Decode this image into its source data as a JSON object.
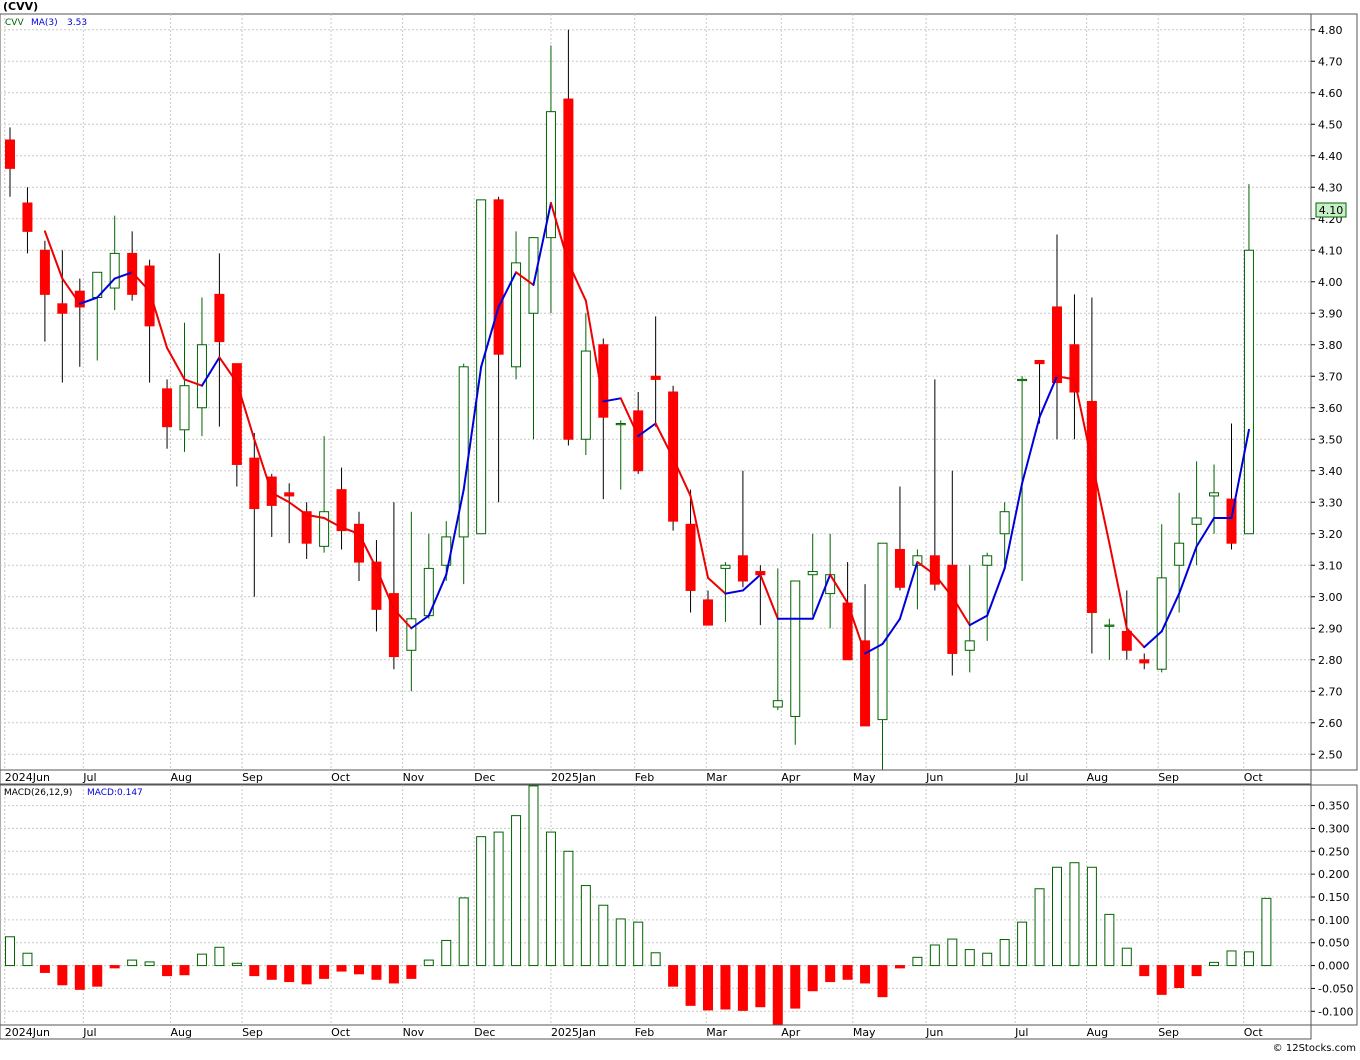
{
  "header": {
    "symbol_title": "(CVV)"
  },
  "price_panel": {
    "legend_symbol": "CVV",
    "legend_ma_label": "MA(3)",
    "legend_ma_value": "3.53",
    "last_price_badge": "4.10"
  },
  "macd_panel": {
    "legend_label": "MACD(26,12,9)",
    "legend_value": "MACD:0.147"
  },
  "footer": {
    "watermark": "© 12Stocks.com"
  },
  "colors": {
    "up": "#006400",
    "down": "#ff0000",
    "ma_up": "#0000dd",
    "ma_down": "#ee0000",
    "grid": "#c8c8c8",
    "badge_bg": "#c8f0c8"
  },
  "chart_data": [
    {
      "type": "candlestick",
      "interval": "weekly",
      "title": "(CVV)",
      "ylim": [
        2.45,
        4.85
      ],
      "y_ticks": [
        "2.50",
        "2.60",
        "2.70",
        "2.80",
        "2.90",
        "3.00",
        "3.10",
        "3.20",
        "3.30",
        "3.40",
        "3.50",
        "3.60",
        "3.70",
        "3.80",
        "3.90",
        "4.00",
        "4.10",
        "4.20",
        "4.30",
        "4.40",
        "4.50",
        "4.60",
        "4.70",
        "4.80"
      ],
      "x_tick_labels": [
        {
          "label": "2024Jun",
          "index": -0.3
        },
        {
          "label": "Jul",
          "index": 4.2
        },
        {
          "label": "Aug",
          "index": 9.2
        },
        {
          "label": "Sep",
          "index": 13.3
        },
        {
          "label": "Oct",
          "index": 18.4
        },
        {
          "label": "Nov",
          "index": 22.5
        },
        {
          "label": "Dec",
          "index": 26.6
        },
        {
          "label": "2025Jan",
          "index": 31.0
        },
        {
          "label": "Feb",
          "index": 35.8
        },
        {
          "label": "Mar",
          "index": 39.9
        },
        {
          "label": "Apr",
          "index": 44.2
        },
        {
          "label": "May",
          "index": 48.3
        },
        {
          "label": "Jun",
          "index": 52.5
        },
        {
          "label": "Jul",
          "index": 57.6
        },
        {
          "label": "Aug",
          "index": 61.7
        },
        {
          "label": "Sep",
          "index": 65.8
        },
        {
          "label": "Oct",
          "index": 70.7
        }
      ],
      "series": [
        {
          "kind": "ohlc",
          "open": [
            4.45,
            4.25,
            4.1,
            3.93,
            3.97,
            3.95,
            3.98,
            4.09,
            4.05,
            3.66,
            3.53,
            3.6,
            3.96,
            3.74,
            3.44,
            3.38,
            3.33,
            3.27,
            3.16,
            3.34,
            3.23,
            3.11,
            3.01,
            2.83,
            2.94,
            3.1,
            3.19,
            3.2,
            4.26,
            3.73,
            3.9,
            4.14,
            4.58,
            3.5,
            3.8,
            3.55,
            3.59,
            3.7,
            3.65,
            3.23,
            2.99,
            3.09,
            3.13,
            3.08,
            2.65,
            2.62,
            3.07,
            3.01,
            2.98,
            2.86,
            2.61,
            3.15,
            3.1,
            3.13,
            3.1,
            2.83,
            3.1,
            3.2,
            3.69,
            3.75,
            3.92,
            3.8,
            3.62,
            2.91,
            2.89,
            2.8,
            2.77,
            3.1,
            3.23,
            3.32,
            3.31,
            3.2
          ],
          "high": [
            4.49,
            4.3,
            4.13,
            4.1,
            4.01,
            4.02,
            4.21,
            4.16,
            4.07,
            3.69,
            3.87,
            3.95,
            4.09,
            3.74,
            3.52,
            3.39,
            3.36,
            3.3,
            3.51,
            3.41,
            3.27,
            3.18,
            3.3,
            3.27,
            3.2,
            3.24,
            3.74,
            3.75,
            4.27,
            4.16,
            4.0,
            4.75,
            4.8,
            3.9,
            3.82,
            3.56,
            3.65,
            3.89,
            3.67,
            3.34,
            3.02,
            3.11,
            3.4,
            3.1,
            3.09,
            3.03,
            3.2,
            3.2,
            3.11,
            3.04,
            3.1,
            3.35,
            3.15,
            3.69,
            3.4,
            3.1,
            3.14,
            3.3,
            3.7,
            3.75,
            4.15,
            3.96,
            3.95,
            2.93,
            3.02,
            2.82,
            3.23,
            3.33,
            3.43,
            3.42,
            3.55,
            4.31
          ],
          "low": [
            4.27,
            4.09,
            3.81,
            3.68,
            3.73,
            3.75,
            3.91,
            3.94,
            3.68,
            3.47,
            3.46,
            3.51,
            3.54,
            3.35,
            3.0,
            3.19,
            3.17,
            3.12,
            3.14,
            3.15,
            3.05,
            2.89,
            2.77,
            2.7,
            2.93,
            3.05,
            3.04,
            3.3,
            3.3,
            3.69,
            3.5,
            3.9,
            3.48,
            3.45,
            3.31,
            3.34,
            3.39,
            3.54,
            3.21,
            2.95,
            2.91,
            2.92,
            3.03,
            2.91,
            2.64,
            2.53,
            2.94,
            2.9,
            2.91,
            2.65,
            2.44,
            3.02,
            2.96,
            3.02,
            2.75,
            2.76,
            2.86,
            3.1,
            3.05,
            3.55,
            3.5,
            3.5,
            2.82,
            2.8,
            2.8,
            2.77,
            2.76,
            2.95,
            3.1,
            3.2,
            3.15,
            3.2
          ],
          "close": [
            4.36,
            4.16,
            3.96,
            3.9,
            3.92,
            4.03,
            4.09,
            3.96,
            3.86,
            3.54,
            3.67,
            3.8,
            3.81,
            3.42,
            3.28,
            3.29,
            3.32,
            3.17,
            3.27,
            3.21,
            3.11,
            2.96,
            2.81,
            2.93,
            3.09,
            3.19,
            3.73,
            4.26,
            3.77,
            4.06,
            4.14,
            4.54,
            3.5,
            3.78,
            3.57,
            3.55,
            3.4,
            3.69,
            3.24,
            3.02,
            2.91,
            3.1,
            3.05,
            3.07,
            2.67,
            3.05,
            3.08,
            3.07,
            2.8,
            2.59,
            3.17,
            3.03,
            3.13,
            3.04,
            2.82,
            2.86,
            3.13,
            3.27,
            3.69,
            3.74,
            3.68,
            3.65,
            2.95,
            2.91,
            2.83,
            2.79,
            3.06,
            3.17,
            3.25,
            3.33,
            3.17,
            4.1
          ]
        },
        {
          "kind": "moving_average",
          "name": "MA(3)",
          "values": [
            null,
            null,
            4.16,
            4.01,
            3.93,
            3.95,
            4.01,
            4.03,
            3.97,
            3.79,
            3.69,
            3.67,
            3.76,
            3.68,
            3.5,
            3.33,
            3.3,
            3.26,
            3.25,
            3.22,
            3.2,
            3.09,
            2.96,
            2.9,
            2.94,
            3.07,
            3.34,
            3.73,
            3.92,
            4.03,
            3.99,
            4.25,
            4.06,
            3.94,
            3.62,
            3.63,
            3.51,
            3.55,
            3.44,
            3.32,
            3.06,
            3.01,
            3.02,
            3.07,
            2.93,
            2.93,
            2.93,
            3.07,
            2.98,
            2.82,
            2.85,
            2.93,
            3.11,
            3.07,
            3.0,
            2.91,
            2.94,
            3.09,
            3.36,
            3.57,
            3.7,
            3.69,
            3.43,
            3.17,
            2.9,
            2.84,
            2.89,
            3.01,
            3.16,
            3.25,
            3.25,
            3.53
          ]
        }
      ]
    },
    {
      "type": "bar",
      "name": "MACD(26,12,9)",
      "ylim": [
        -0.13,
        0.395
      ],
      "y_ticks": [
        "0.350",
        "0.300",
        "0.250",
        "0.200",
        "0.150",
        "0.100",
        "0.050",
        "0.000",
        "-0.050",
        "-0.100"
      ],
      "x_tick_labels": [
        {
          "label": "2024Jun",
          "index": -0.3
        },
        {
          "label": "Jul",
          "index": 4.2
        },
        {
          "label": "Aug",
          "index": 9.2
        },
        {
          "label": "Sep",
          "index": 13.3
        },
        {
          "label": "Oct",
          "index": 18.4
        },
        {
          "label": "Nov",
          "index": 22.5
        },
        {
          "label": "Dec",
          "index": 26.6
        },
        {
          "label": "2025Jan",
          "index": 31.0
        },
        {
          "label": "Feb",
          "index": 35.8
        },
        {
          "label": "Mar",
          "index": 39.9
        },
        {
          "label": "Apr",
          "index": 44.2
        },
        {
          "label": "May",
          "index": 48.3
        },
        {
          "label": "Jun",
          "index": 52.5
        },
        {
          "label": "Jul",
          "index": 57.6
        },
        {
          "label": "Aug",
          "index": 61.7
        },
        {
          "label": "Sep",
          "index": 65.8
        },
        {
          "label": "Oct",
          "index": 70.7
        }
      ],
      "values": [
        0.063,
        0.027,
        -0.015,
        -0.042,
        -0.052,
        -0.045,
        -0.005,
        0.012,
        0.008,
        -0.022,
        -0.02,
        0.025,
        0.04,
        0.005,
        -0.022,
        -0.03,
        -0.035,
        -0.04,
        -0.028,
        -0.012,
        -0.018,
        -0.03,
        -0.038,
        -0.028,
        0.012,
        0.055,
        0.148,
        0.282,
        0.292,
        0.328,
        0.393,
        0.292,
        0.25,
        0.175,
        0.132,
        0.102,
        0.095,
        0.028,
        -0.045,
        -0.087,
        -0.097,
        -0.095,
        -0.098,
        -0.09,
        -0.13,
        -0.093,
        -0.055,
        -0.035,
        -0.03,
        -0.038,
        -0.068,
        -0.005,
        0.018,
        0.045,
        0.058,
        0.035,
        0.027,
        0.057,
        0.095,
        0.168,
        0.215,
        0.225,
        0.215,
        0.112,
        0.038,
        -0.022,
        -0.063,
        -0.048,
        -0.022,
        0.007,
        0.032,
        0.03,
        0.147
      ]
    }
  ]
}
